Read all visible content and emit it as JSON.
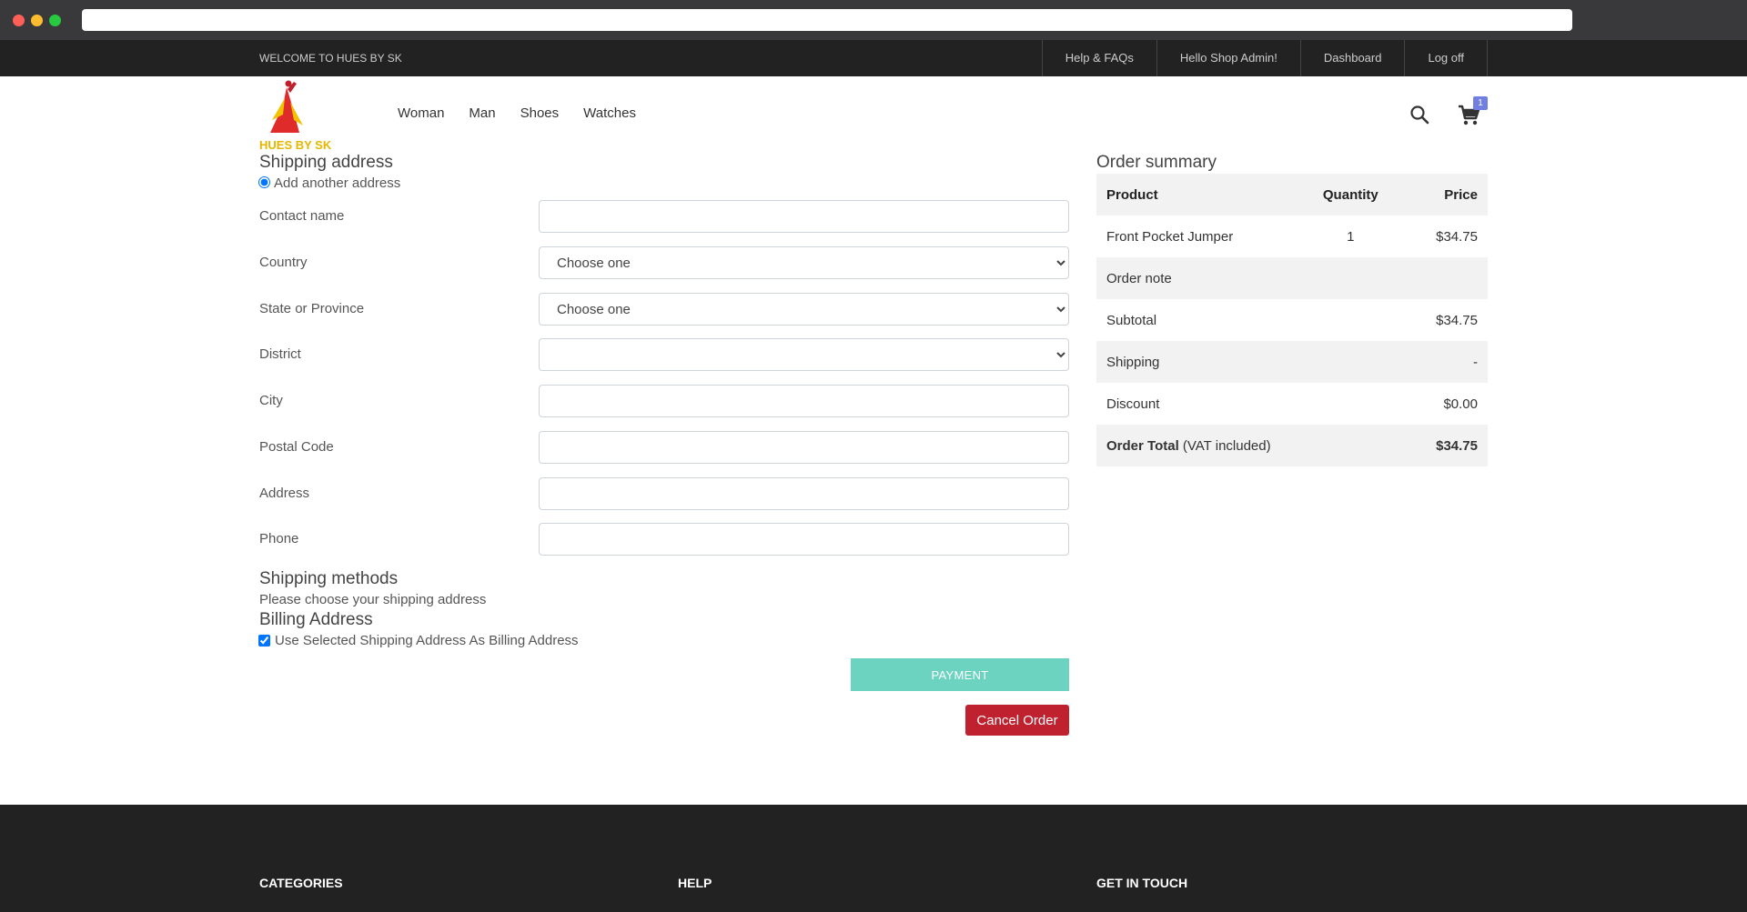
{
  "topbar": {
    "welcome": "WELCOME TO HUES BY SK",
    "links": [
      "Help & FAQs",
      "Hello Shop Admin!",
      "Dashboard",
      "Log off"
    ]
  },
  "logo": {
    "text": "HUES BY SK"
  },
  "nav": {
    "items": [
      "Woman",
      "Man",
      "Shoes",
      "Watches"
    ]
  },
  "cart": {
    "count": "1"
  },
  "shipping": {
    "title": "Shipping address",
    "add_another": "Add another address",
    "fields": {
      "contact_name": {
        "label": "Contact name",
        "value": ""
      },
      "country": {
        "label": "Country",
        "value": "Choose one"
      },
      "state": {
        "label": "State or Province",
        "value": "Choose one"
      },
      "district": {
        "label": "District",
        "value": ""
      },
      "city": {
        "label": "City",
        "value": ""
      },
      "postal_code": {
        "label": "Postal Code",
        "value": ""
      },
      "address": {
        "label": "Address",
        "value": ""
      },
      "phone": {
        "label": "Phone",
        "value": ""
      }
    },
    "methods_title": "Shipping methods",
    "methods_note": "Please choose your shipping address",
    "billing_title": "Billing Address",
    "billing_checkbox": "Use Selected Shipping Address As Billing Address",
    "payment_button": "Payment",
    "cancel_button": "Cancel Order"
  },
  "summary": {
    "title": "Order summary",
    "headers": {
      "product": "Product",
      "quantity": "Quantity",
      "price": "Price"
    },
    "item": {
      "name": "Front Pocket Jumper",
      "quantity": "1",
      "price": "$34.75"
    },
    "order_note": "Order note",
    "subtotal_label": "Subtotal",
    "subtotal": "$34.75",
    "shipping_label": "Shipping",
    "shipping": "-",
    "discount_label": "Discount",
    "discount": "$0.00",
    "total_label": "Order Total",
    "total_note": "(VAT included)",
    "total": "$34.75"
  },
  "footer": {
    "headings": [
      "Categories",
      "Help",
      "Get in touch"
    ]
  },
  "colors": {
    "accent": "#717fe0",
    "payment": "#6dd3c1",
    "cancel": "#c0212f",
    "dark": "#222222"
  }
}
